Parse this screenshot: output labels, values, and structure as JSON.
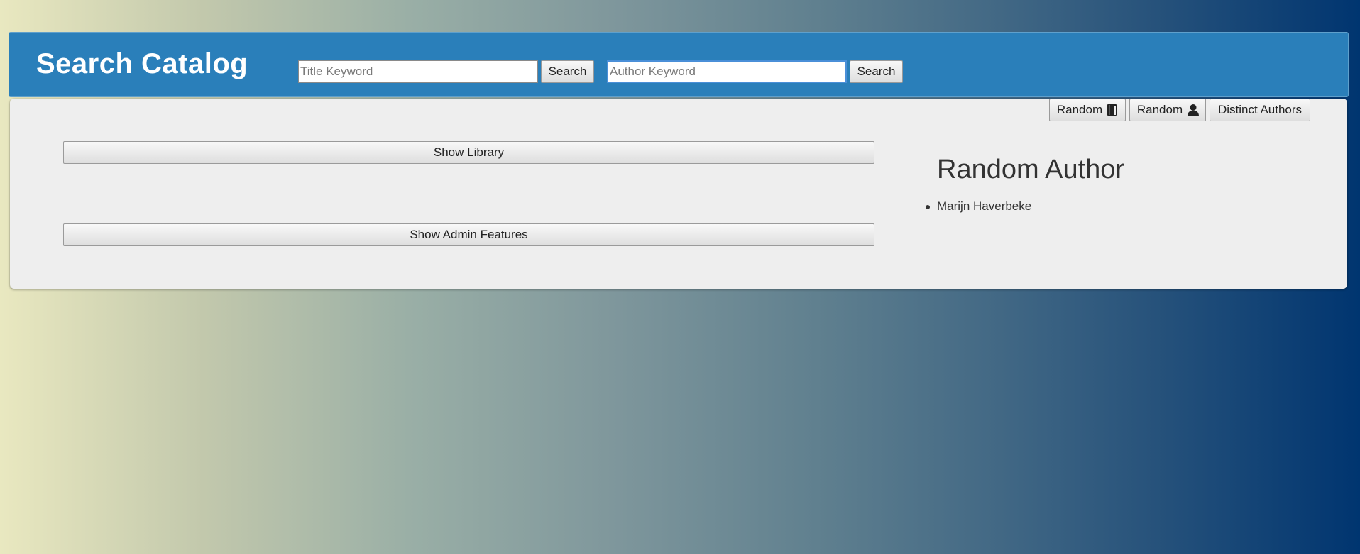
{
  "header": {
    "title": "Search Catalog",
    "title_search": {
      "placeholder": "Title Keyword",
      "button_label": "Search"
    },
    "author_search": {
      "placeholder": "Author Keyword",
      "button_label": "Search"
    },
    "bar_color": "#2a7fba"
  },
  "toolbar": {
    "random_book_label": "Random",
    "random_book_icon": "book-icon",
    "random_author_label": "Random",
    "random_author_icon": "user-icon",
    "distinct_authors_label": "Distinct Authors"
  },
  "main": {
    "show_library_label": "Show Library",
    "show_admin_label": "Show Admin Features"
  },
  "sidebar": {
    "title": "Random Author",
    "items": [
      "Marijn Haverbeke"
    ]
  }
}
